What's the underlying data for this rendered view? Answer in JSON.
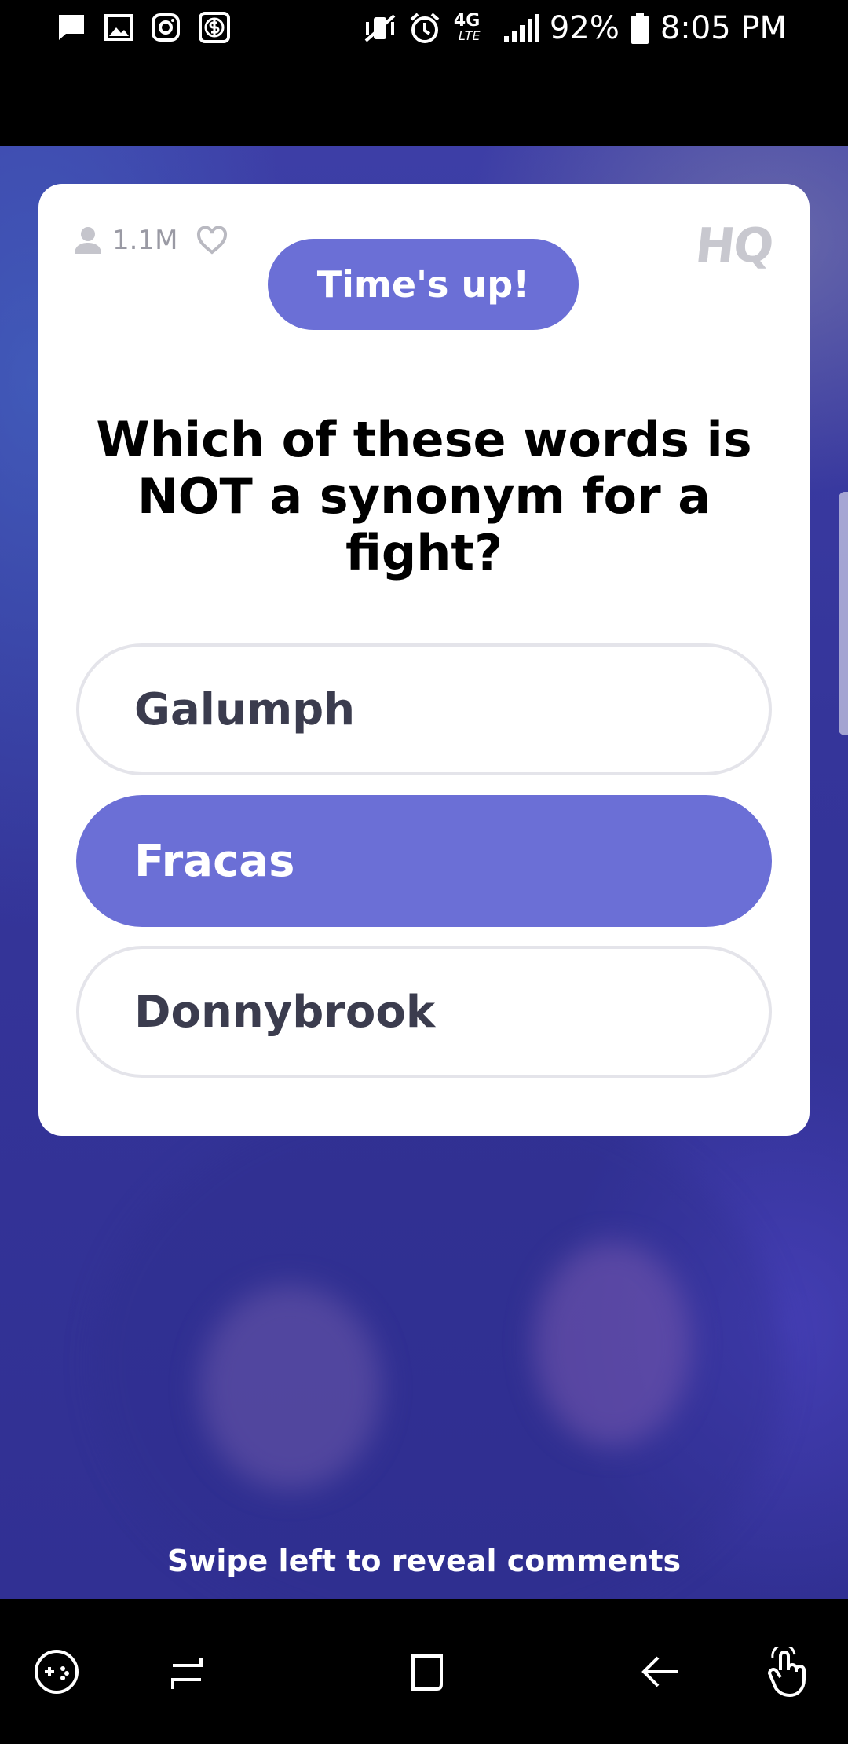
{
  "status_bar": {
    "battery": "92%",
    "time": "8:05 PM",
    "network": "4G",
    "network_sub": "LTE",
    "left_icons": [
      "message-icon",
      "image-icon",
      "instagram-icon",
      "cash-icon"
    ],
    "right_icons": [
      "vibrate-mute-icon",
      "alarm-icon",
      "signal-icon",
      "battery-icon"
    ]
  },
  "game": {
    "viewer_count": "1.1M",
    "logo": "HQ",
    "timer_label": "Time's up!",
    "question": "Which of these words is NOT a synonym for a fight?",
    "answers": [
      {
        "label": "Galumph",
        "selected": false
      },
      {
        "label": "Fracas",
        "selected": true
      },
      {
        "label": "Donnybrook",
        "selected": false
      }
    ],
    "hint": "Swipe left to reveal comments"
  },
  "nav_bar": {
    "items": [
      "gamepad-icon",
      "recent-apps-icon",
      "home-icon",
      "back-icon",
      "gesture-icon"
    ]
  },
  "colors": {
    "accent": "#6b6fd6",
    "background": "#35359a",
    "answer_border": "#e4e4ea"
  }
}
